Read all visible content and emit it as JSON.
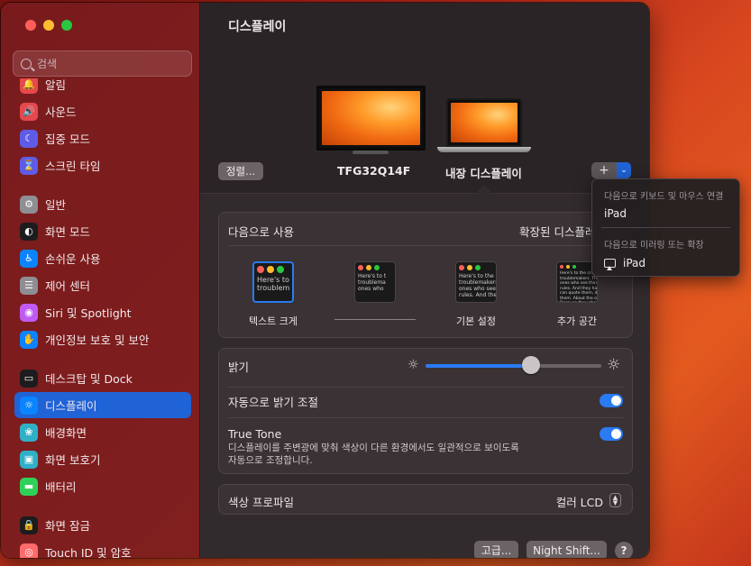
{
  "window": {
    "title": "디스플레이"
  },
  "search": {
    "placeholder": "검색"
  },
  "sidebar": {
    "items": [
      {
        "label": "알림",
        "icon": "bell-icon",
        "color": "#e5484d",
        "glyph": "🔔"
      },
      {
        "label": "사운드",
        "icon": "speaker-icon",
        "color": "#e5484d",
        "glyph": "🔊"
      },
      {
        "label": "집중 모드",
        "icon": "moon-icon",
        "color": "#5e5ce6",
        "glyph": "☾"
      },
      {
        "label": "스크린 타임",
        "icon": "hourglass-icon",
        "color": "#5e5ce6",
        "glyph": "⌛"
      },
      {
        "label": "일반",
        "icon": "gear-icon",
        "color": "#8e8e93",
        "glyph": "⚙"
      },
      {
        "label": "화면 모드",
        "icon": "appearance-icon",
        "color": "#1c1c1e",
        "glyph": "◐"
      },
      {
        "label": "손쉬운 사용",
        "icon": "accessibility-icon",
        "color": "#0a84ff",
        "glyph": "♿"
      },
      {
        "label": "제어 센터",
        "icon": "control-center-icon",
        "color": "#8e8e93",
        "glyph": "☰"
      },
      {
        "label": "Siri 및 Spotlight",
        "icon": "siri-icon",
        "color": "#bf5af2",
        "glyph": "◉"
      },
      {
        "label": "개인정보 보호 및 보안",
        "icon": "hand-icon",
        "color": "#0a84ff",
        "glyph": "✋"
      },
      {
        "label": "데스크탑 및 Dock",
        "icon": "dock-icon",
        "color": "#1c1c1e",
        "glyph": "▭"
      },
      {
        "label": "디스플레이",
        "icon": "display-sun-icon",
        "color": "#0a84ff",
        "glyph": "☼"
      },
      {
        "label": "배경화면",
        "icon": "wallpaper-icon",
        "color": "#30b0c7",
        "glyph": "❀"
      },
      {
        "label": "화면 보호기",
        "icon": "screensaver-icon",
        "color": "#30b0c7",
        "glyph": "▣"
      },
      {
        "label": "배터리",
        "icon": "battery-icon",
        "color": "#30d158",
        "glyph": "▬"
      },
      {
        "label": "화면 잠금",
        "icon": "lock-icon",
        "color": "#1c1c1e",
        "glyph": "🔒"
      },
      {
        "label": "Touch ID 및 암호",
        "icon": "fingerprint-icon",
        "color": "#ff6b6b",
        "glyph": "◎"
      }
    ],
    "active_index": 11
  },
  "arrangement": {
    "arrange_button": "정렬...",
    "external_display": "TFG32Q14F",
    "internal_display": "내장 디스플레이",
    "add_button": "+",
    "add_caret": "⌄"
  },
  "use_as": {
    "label": "다음으로 사용",
    "value": "확장된 디스플레",
    "options": [
      {
        "label": "텍스트 크게",
        "lines": [
          "Here's to",
          "troublem"
        ]
      },
      {
        "label": "",
        "lines": [
          "Here's to t",
          "troublema",
          "ones who"
        ]
      },
      {
        "label": "기본 설정",
        "lines": [
          "Here's to the cr",
          "troublemakers.",
          "ones who see th",
          "rules. And they"
        ]
      },
      {
        "label": "추가 공간",
        "lines": [
          "Here's to the crazy one",
          "troublemakers. The ro",
          "ones who see things di",
          "rules. And they have n",
          "can quote them, disagr",
          "them. About the only th",
          "Because they change th"
        ]
      }
    ]
  },
  "brightness": {
    "label": "밝기",
    "level": 0.6,
    "auto_label": "자동으로 밝기 조절",
    "auto_on": true,
    "true_tone_label": "True Tone",
    "true_tone_desc_1": "디스플레이를 주변광에 맞춰 색상이 다른 환경에서도 일관적으로 보이도록",
    "true_tone_desc_2": "자동으로 조정합니다.",
    "true_tone_on": true
  },
  "color_profile": {
    "label": "색상 프로파일",
    "value": "컬러 LCD"
  },
  "footer": {
    "advanced": "고급...",
    "night_shift": "Night Shift...",
    "help": "?"
  },
  "popup": {
    "header_1": "다음으로 키보드 및 마우스 연결",
    "item_1": "iPad",
    "header_2": "다음으로 미러링 또는 확장",
    "item_2": "iPad"
  },
  "colors": {
    "accent": "#1f63d6",
    "sidebar_bg": "#781c1e",
    "toggle_on": "#2a7bf4"
  }
}
